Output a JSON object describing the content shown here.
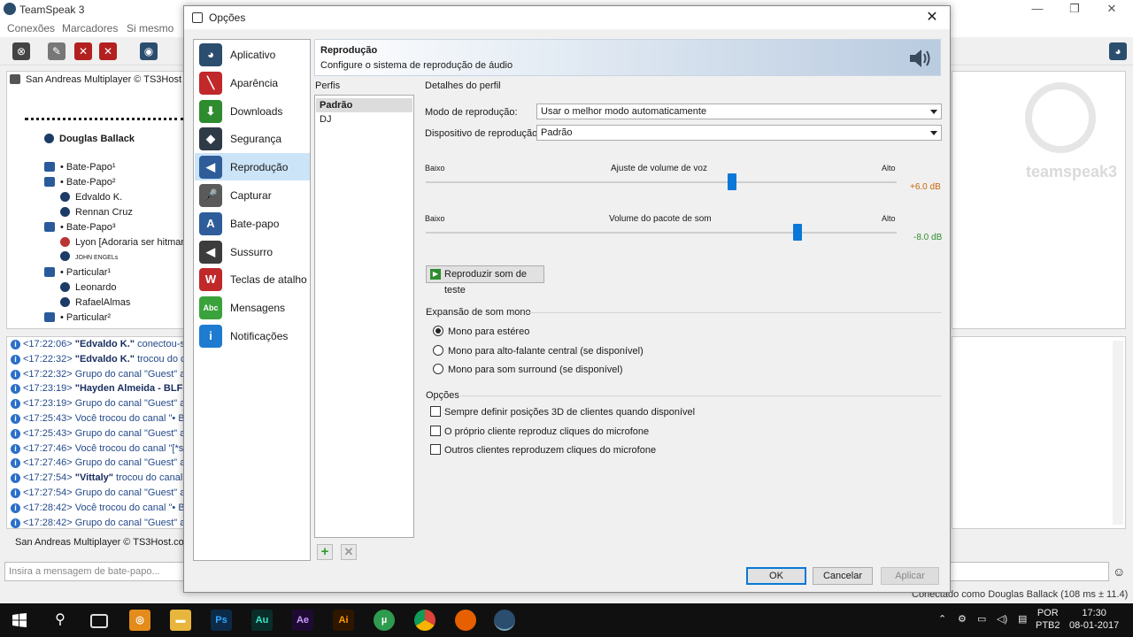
{
  "ts": {
    "title": "TeamSpeak 3",
    "menu": [
      "Conexões",
      "Marcadores",
      "Si mesmo"
    ],
    "server": "San Andreas Multiplayer © TS3Host",
    "tree": [
      {
        "text": "Douglas Ballack"
      },
      {
        "text": "• Bate-Papo¹"
      },
      {
        "text": "• Bate-Papo²"
      },
      {
        "text": "Edvaldo K."
      },
      {
        "text": "Rennan Cruz"
      },
      {
        "text": "• Bate-Papo³"
      },
      {
        "text": "Lyon [Adoraria ser hitman"
      },
      {
        "text": "JOHN ENGELs"
      },
      {
        "text": "• Particular¹"
      },
      {
        "text": "Leonardo"
      },
      {
        "text": "RafaelAlmas"
      },
      {
        "text": "• Particular²"
      }
    ],
    "log": [
      {
        "time": "<17:22:06>",
        "bold": "\"Edvaldo K.\"",
        "rest": " conectou-se"
      },
      {
        "time": "<17:22:32>",
        "bold": "\"Edvaldo K.\"",
        "rest": " trocou do ca"
      },
      {
        "time": "<17:22:32>",
        "bold": "",
        "rest": " Grupo do canal \"Guest\" atri"
      },
      {
        "time": "<17:23:19>",
        "bold": "\"Hayden Almeida - BLF",
        "rest": ""
      },
      {
        "time": "<17:23:19>",
        "bold": "",
        "rest": " Grupo do canal \"Guest\" atri"
      },
      {
        "time": "<17:25:43>",
        "bold": "",
        "rest": " Você trocou do canal \"• Ba"
      },
      {
        "time": "<17:25:43>",
        "bold": "",
        "rest": " Grupo do canal \"Guest\" atri"
      },
      {
        "time": "<17:27:46>",
        "bold": "",
        "rest": " Você trocou do canal \"[*sp"
      },
      {
        "time": "<17:27:46>",
        "bold": "",
        "rest": " Grupo do canal \"Guest\" atri"
      },
      {
        "time": "<17:27:54>",
        "bold": "\"Vittaly\"",
        "rest": " trocou do canal"
      },
      {
        "time": "<17:27:54>",
        "bold": "",
        "rest": " Grupo do canal \"Guest\" atri"
      },
      {
        "time": "<17:28:42>",
        "bold": "",
        "rest": " Você trocou do canal \"• Ba"
      },
      {
        "time": "<17:28:42>",
        "bold": "",
        "rest": " Grupo do canal \"Guest\" atri"
      }
    ],
    "tab": "San Andreas Multiplayer © TS3Host.co",
    "chat_placeholder": "Insira a mensagem de bate-papo...",
    "status": "Conectado como Douglas Ballack (108 ms ± 11.4)",
    "watermark": "teamspeak3"
  },
  "dialog": {
    "title": "Opções",
    "nav": [
      {
        "label": "Aplicativo",
        "color": "#2b4d6e",
        "glyph": "◕"
      },
      {
        "label": "Aparência",
        "color": "#c0282a",
        "glyph": "╲"
      },
      {
        "label": "Downloads",
        "color": "#2e8b2e",
        "glyph": "⬇"
      },
      {
        "label": "Segurança",
        "color": "#2f3a47",
        "glyph": "◆"
      },
      {
        "label": "Reprodução",
        "color": "#2e5d9a",
        "glyph": "◀"
      },
      {
        "label": "Capturar",
        "color": "#5a5a5a",
        "glyph": "🎤"
      },
      {
        "label": "Bate-papo",
        "color": "#2e5d9a",
        "glyph": "A"
      },
      {
        "label": "Sussurro",
        "color": "#3c3c3c",
        "glyph": "◀"
      },
      {
        "label": "Teclas de atalho",
        "color": "#c0282a",
        "glyph": "W"
      },
      {
        "label": "Mensagens",
        "color": "#3aa23a",
        "glyph": "Abc"
      },
      {
        "label": "Notificações",
        "color": "#1e7bd0",
        "glyph": "i"
      }
    ],
    "selected_nav_index": 4,
    "header": {
      "title": "Reprodução",
      "subtitle": "Configure o sistema de reprodução de áudio"
    },
    "profiles_label": "Perfis",
    "profiles": [
      "Padrão",
      "DJ"
    ],
    "details_label": "Detalhes do perfil",
    "mode_label": "Modo de reprodução:",
    "mode_value": "Usar o melhor modo automaticamente",
    "device_label": "Dispositivo de reprodução:",
    "device_value": "Padrão",
    "voice": {
      "low": "Baixo",
      "title": "Ajuste de volume de voz",
      "high": "Alto",
      "value_text": "+6.0 dB",
      "value_color": "#c8650a",
      "level": 0.65
    },
    "sound": {
      "low": "Baixo",
      "title": "Volume do pacote de som",
      "high": "Alto",
      "value_text": "-8.0 dB",
      "value_color": "#2e8b2e",
      "level": 0.79
    },
    "test_button": "Reproduzir som de teste",
    "mono_label": "Expansão de som mono",
    "mono_options": [
      "Mono para estéreo",
      "Mono para alto-falante central (se disponível)",
      "Mono para som surround (se disponível)"
    ],
    "mono_selected": 0,
    "opts_label": "Opções",
    "checkboxes": [
      {
        "label": "Sempre definir posições 3D de clientes quando disponível",
        "checked": false
      },
      {
        "label": "O próprio cliente reproduz cliques do microfone",
        "checked": false
      },
      {
        "label": "Outros clientes reproduzem cliques do microfone",
        "checked": false
      }
    ],
    "ok": "OK",
    "cancel": "Cancelar",
    "apply": "Aplicar"
  },
  "taskbar": {
    "apps": [
      "Ps",
      "Au",
      "Ae",
      "Ai"
    ],
    "lang": "POR",
    "layout": "PTB2",
    "time": "17:30",
    "date": "08-01-2017"
  }
}
